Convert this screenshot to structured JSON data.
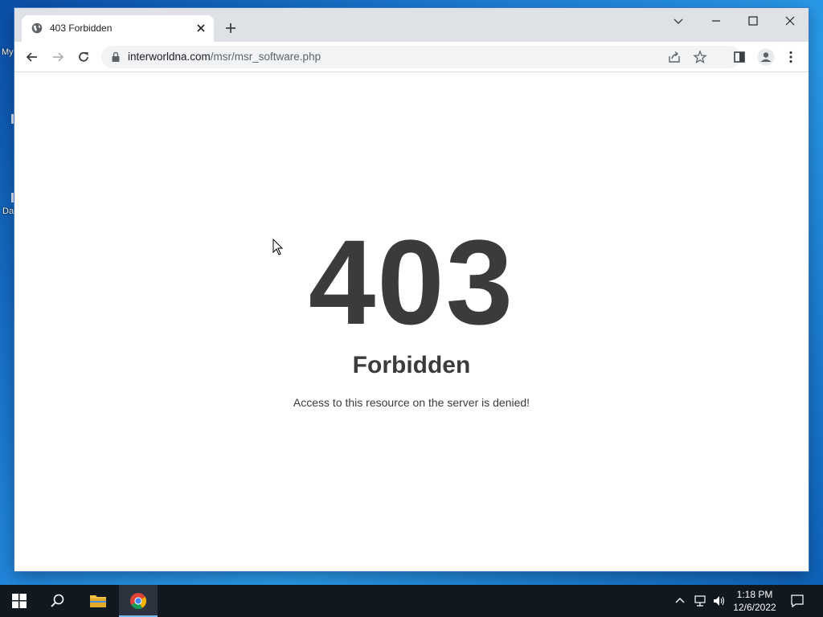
{
  "desktop": {
    "icon_label_1": "My",
    "icon_label_2": "Da"
  },
  "browser": {
    "tab": {
      "title": "403 Forbidden"
    },
    "address": {
      "domain": "interworldna.com",
      "path": "/msr/msr_software.php"
    }
  },
  "page": {
    "code": "403",
    "title": "Forbidden",
    "message": "Access to this resource on the server is denied!"
  },
  "taskbar": {
    "time": "1:18 PM",
    "date": "12/6/2022"
  }
}
